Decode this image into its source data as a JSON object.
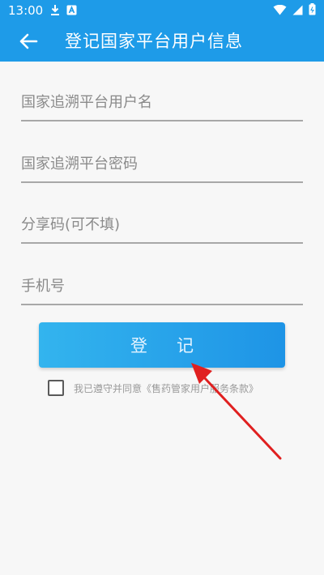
{
  "status_bar": {
    "time": "13:00",
    "left_icons": [
      "download-icon",
      "app-notification-icon"
    ],
    "right_icons": [
      "wifi-icon",
      "signal-icon",
      "battery-icon"
    ]
  },
  "app_bar": {
    "back_icon": "arrow-left-icon",
    "title": "登记国家平台用户信息"
  },
  "form": {
    "username_placeholder": "国家追溯平台用户名",
    "password_placeholder": "国家追溯平台密码",
    "share_code_placeholder": "分享码(可不填)",
    "phone_placeholder": "手机号",
    "register_label": "登记"
  },
  "agreement": {
    "checked": false,
    "prefix": "我已遵守并同意",
    "link": "《售药管家用户服务条款》"
  },
  "colors": {
    "primary": "#1e9be8",
    "button_gradient_start": "#33b4ee",
    "button_gradient_end": "#1e94e6",
    "annotation_arrow": "#e02020"
  }
}
